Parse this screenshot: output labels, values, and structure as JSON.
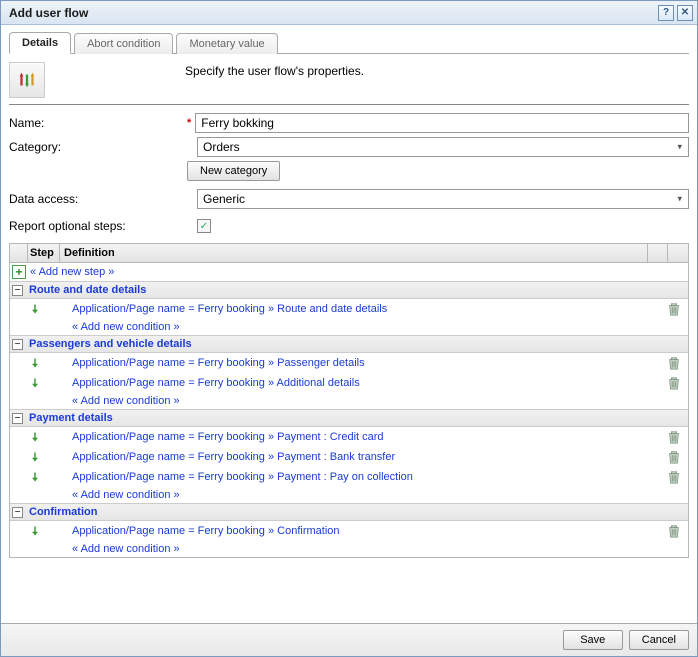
{
  "title": "Add user flow",
  "tabs": [
    "Details",
    "Abort condition",
    "Monetary value"
  ],
  "activeTab": 0,
  "intro": "Specify the user flow's properties.",
  "fields": {
    "name_label": "Name:",
    "name_value": "Ferry bokking",
    "category_label": "Category:",
    "category_value": "Orders",
    "new_category_btn": "New category",
    "data_access_label": "Data access:",
    "data_access_value": "Generic",
    "report_optional_label": "Report optional steps:",
    "report_optional_checked": true
  },
  "table": {
    "col_step": "Step",
    "col_definition": "Definition",
    "add_new_step": "« Add new step »",
    "add_new_condition": "« Add new condition »",
    "groups": [
      {
        "title": "Route and date details",
        "rows": [
          "Application/Page name = Ferry booking » Route and date details"
        ]
      },
      {
        "title": "Passengers and vehicle details",
        "rows": [
          "Application/Page name = Ferry booking » Passenger details",
          "Application/Page name = Ferry booking » Additional details"
        ]
      },
      {
        "title": "Payment details",
        "rows": [
          "Application/Page name = Ferry booking » Payment : Credit card",
          "Application/Page name = Ferry booking » Payment : Bank transfer",
          "Application/Page name = Ferry booking » Payment : Pay on collection"
        ]
      },
      {
        "title": "Confirmation",
        "rows": [
          "Application/Page name = Ferry booking » Confirmation"
        ]
      }
    ]
  },
  "footer": {
    "save": "Save",
    "cancel": "Cancel"
  }
}
